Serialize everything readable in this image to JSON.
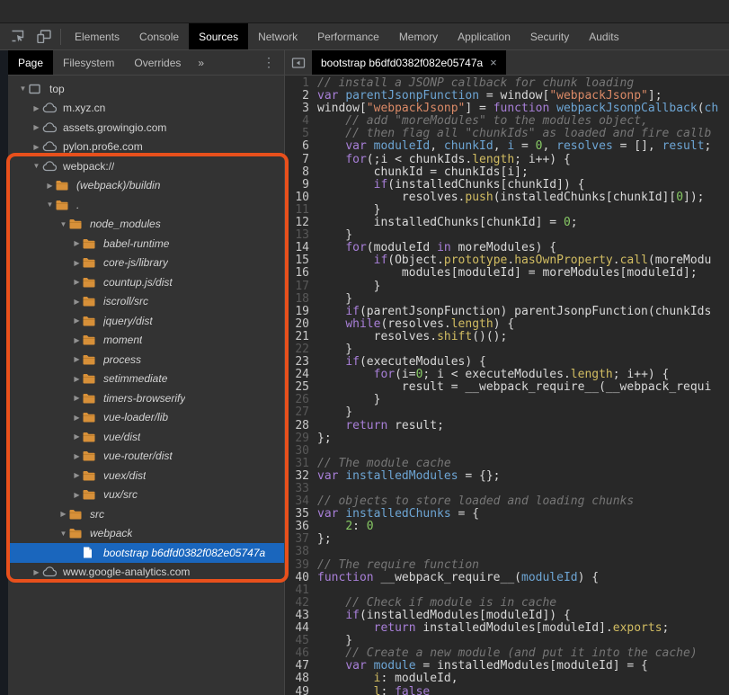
{
  "toolbar": {
    "tabs": [
      "Elements",
      "Console",
      "Sources",
      "Network",
      "Performance",
      "Memory",
      "Application",
      "Security",
      "Audits"
    ],
    "active_tab": "Sources"
  },
  "sidebar": {
    "tabs": [
      "Page",
      "Filesystem",
      "Overrides"
    ],
    "active_tab": "Page",
    "overflow_chevron": "»",
    "more_menu_glyph": "⋮",
    "tree": [
      {
        "label": "top",
        "depth": 0,
        "icon": "frame",
        "expander": "expanded",
        "italic": false,
        "selected": false
      },
      {
        "label": "m.xyz.cn",
        "depth": 1,
        "icon": "cloud",
        "expander": "collapsed",
        "italic": false,
        "selected": false
      },
      {
        "label": "assets.growingio.com",
        "depth": 1,
        "icon": "cloud",
        "expander": "collapsed",
        "italic": false,
        "selected": false
      },
      {
        "label": "pylon.pro6e.com",
        "depth": 1,
        "icon": "cloud",
        "expander": "collapsed",
        "italic": false,
        "selected": false
      },
      {
        "label": "webpack://",
        "depth": 1,
        "icon": "cloud",
        "expander": "expanded",
        "italic": false,
        "selected": false
      },
      {
        "label": "(webpack)/buildin",
        "depth": 2,
        "icon": "folder",
        "expander": "collapsed",
        "italic": true,
        "selected": false
      },
      {
        "label": ".",
        "depth": 2,
        "icon": "folder",
        "expander": "expanded",
        "italic": true,
        "selected": false
      },
      {
        "label": "node_modules",
        "depth": 3,
        "icon": "folder",
        "expander": "expanded",
        "italic": true,
        "selected": false
      },
      {
        "label": "babel-runtime",
        "depth": 4,
        "icon": "folder",
        "expander": "collapsed",
        "italic": true,
        "selected": false
      },
      {
        "label": "core-js/library",
        "depth": 4,
        "icon": "folder",
        "expander": "collapsed",
        "italic": true,
        "selected": false
      },
      {
        "label": "countup.js/dist",
        "depth": 4,
        "icon": "folder",
        "expander": "collapsed",
        "italic": true,
        "selected": false
      },
      {
        "label": "iscroll/src",
        "depth": 4,
        "icon": "folder",
        "expander": "collapsed",
        "italic": true,
        "selected": false
      },
      {
        "label": "jquery/dist",
        "depth": 4,
        "icon": "folder",
        "expander": "collapsed",
        "italic": true,
        "selected": false
      },
      {
        "label": "moment",
        "depth": 4,
        "icon": "folder",
        "expander": "collapsed",
        "italic": true,
        "selected": false
      },
      {
        "label": "process",
        "depth": 4,
        "icon": "folder",
        "expander": "collapsed",
        "italic": true,
        "selected": false
      },
      {
        "label": "setimmediate",
        "depth": 4,
        "icon": "folder",
        "expander": "collapsed",
        "italic": true,
        "selected": false
      },
      {
        "label": "timers-browserify",
        "depth": 4,
        "icon": "folder",
        "expander": "collapsed",
        "italic": true,
        "selected": false
      },
      {
        "label": "vue-loader/lib",
        "depth": 4,
        "icon": "folder",
        "expander": "collapsed",
        "italic": true,
        "selected": false
      },
      {
        "label": "vue/dist",
        "depth": 4,
        "icon": "folder",
        "expander": "collapsed",
        "italic": true,
        "selected": false
      },
      {
        "label": "vue-router/dist",
        "depth": 4,
        "icon": "folder",
        "expander": "collapsed",
        "italic": true,
        "selected": false
      },
      {
        "label": "vuex/dist",
        "depth": 4,
        "icon": "folder",
        "expander": "collapsed",
        "italic": true,
        "selected": false
      },
      {
        "label": "vux/src",
        "depth": 4,
        "icon": "folder",
        "expander": "collapsed",
        "italic": true,
        "selected": false
      },
      {
        "label": "src",
        "depth": 3,
        "icon": "folder",
        "expander": "collapsed",
        "italic": true,
        "selected": false
      },
      {
        "label": "webpack",
        "depth": 3,
        "icon": "folder",
        "expander": "expanded",
        "italic": true,
        "selected": false
      },
      {
        "label": "bootstrap b6dfd0382f082e05747a",
        "depth": 4,
        "icon": "file",
        "expander": "none",
        "italic": true,
        "selected": true
      },
      {
        "label": "www.google-analytics.com",
        "depth": 1,
        "icon": "cloud",
        "expander": "collapsed",
        "italic": false,
        "selected": false
      }
    ]
  },
  "editor": {
    "tab": {
      "label": "bootstrap b6dfd0382f082e05747a",
      "close_glyph": "×"
    },
    "code_lines": [
      {
        "n": 1,
        "x": false,
        "t": [
          [
            "cmt",
            "// install a JSONP callback for chunk loading"
          ]
        ]
      },
      {
        "n": 2,
        "x": true,
        "t": [
          [
            "kw",
            "var"
          ],
          [
            "pln",
            " "
          ],
          [
            "def",
            "parentJsonpFunction"
          ],
          [
            "pln",
            " = window["
          ],
          [
            "str",
            "\"webpackJsonp\""
          ],
          [
            "pln",
            "];"
          ]
        ]
      },
      {
        "n": 3,
        "x": true,
        "t": [
          [
            "pln",
            "window["
          ],
          [
            "str",
            "\"webpackJsonp\""
          ],
          [
            "pln",
            "] = "
          ],
          [
            "kw",
            "function"
          ],
          [
            "pln",
            " "
          ],
          [
            "def",
            "webpackJsonpCallback"
          ],
          [
            "pln",
            "("
          ],
          [
            "def",
            "ch"
          ]
        ]
      },
      {
        "n": 4,
        "x": false,
        "t": [
          [
            "cmt",
            "    // add \"moreModules\" to the modules object,"
          ]
        ]
      },
      {
        "n": 5,
        "x": false,
        "t": [
          [
            "cmt",
            "    // then flag all \"chunkIds\" as loaded and fire callb"
          ]
        ]
      },
      {
        "n": 6,
        "x": true,
        "t": [
          [
            "pln",
            "    "
          ],
          [
            "kw",
            "var"
          ],
          [
            "pln",
            " "
          ],
          [
            "def",
            "moduleId"
          ],
          [
            "pln",
            ", "
          ],
          [
            "def",
            "chunkId"
          ],
          [
            "pln",
            ", "
          ],
          [
            "def",
            "i"
          ],
          [
            "pln",
            " = "
          ],
          [
            "num",
            "0"
          ],
          [
            "pln",
            ", "
          ],
          [
            "def",
            "resolves"
          ],
          [
            "pln",
            " = [], "
          ],
          [
            "def",
            "result"
          ],
          [
            "pln",
            ";"
          ]
        ]
      },
      {
        "n": 7,
        "x": true,
        "t": [
          [
            "pln",
            "    "
          ],
          [
            "kw",
            "for"
          ],
          [
            "pln",
            "(;i < chunkIds."
          ],
          [
            "prop",
            "length"
          ],
          [
            "pln",
            "; i++) {"
          ]
        ]
      },
      {
        "n": 8,
        "x": true,
        "t": [
          [
            "pln",
            "        chunkId = chunkIds[i];"
          ]
        ]
      },
      {
        "n": 9,
        "x": true,
        "t": [
          [
            "pln",
            "        "
          ],
          [
            "kw",
            "if"
          ],
          [
            "pln",
            "(installedChunks[chunkId]) {"
          ]
        ]
      },
      {
        "n": 10,
        "x": true,
        "t": [
          [
            "pln",
            "            resolves."
          ],
          [
            "prop",
            "push"
          ],
          [
            "pln",
            "(installedChunks[chunkId]["
          ],
          [
            "num",
            "0"
          ],
          [
            "pln",
            "]);"
          ]
        ]
      },
      {
        "n": 11,
        "x": false,
        "t": [
          [
            "pln",
            "        }"
          ]
        ]
      },
      {
        "n": 12,
        "x": true,
        "t": [
          [
            "pln",
            "        installedChunks[chunkId] = "
          ],
          [
            "num",
            "0"
          ],
          [
            "pln",
            ";"
          ]
        ]
      },
      {
        "n": 13,
        "x": false,
        "t": [
          [
            "pln",
            "    }"
          ]
        ]
      },
      {
        "n": 14,
        "x": true,
        "t": [
          [
            "pln",
            "    "
          ],
          [
            "kw",
            "for"
          ],
          [
            "pln",
            "(moduleId "
          ],
          [
            "kw",
            "in"
          ],
          [
            "pln",
            " moreModules) {"
          ]
        ]
      },
      {
        "n": 15,
        "x": true,
        "t": [
          [
            "pln",
            "        "
          ],
          [
            "kw",
            "if"
          ],
          [
            "pln",
            "(Object."
          ],
          [
            "prop",
            "prototype"
          ],
          [
            "pln",
            "."
          ],
          [
            "prop",
            "hasOwnProperty"
          ],
          [
            "pln",
            "."
          ],
          [
            "prop",
            "call"
          ],
          [
            "pln",
            "(moreModu"
          ]
        ]
      },
      {
        "n": 16,
        "x": true,
        "t": [
          [
            "pln",
            "            modules[moduleId] = moreModules[moduleId];"
          ]
        ]
      },
      {
        "n": 17,
        "x": false,
        "t": [
          [
            "pln",
            "        }"
          ]
        ]
      },
      {
        "n": 18,
        "x": false,
        "t": [
          [
            "pln",
            "    }"
          ]
        ]
      },
      {
        "n": 19,
        "x": true,
        "t": [
          [
            "pln",
            "    "
          ],
          [
            "kw",
            "if"
          ],
          [
            "pln",
            "(parentJsonpFunction) parentJsonpFunction(chunkIds"
          ]
        ]
      },
      {
        "n": 20,
        "x": true,
        "t": [
          [
            "pln",
            "    "
          ],
          [
            "kw",
            "while"
          ],
          [
            "pln",
            "(resolves."
          ],
          [
            "prop",
            "length"
          ],
          [
            "pln",
            ") {"
          ]
        ]
      },
      {
        "n": 21,
        "x": true,
        "t": [
          [
            "pln",
            "        resolves."
          ],
          [
            "prop",
            "shift"
          ],
          [
            "pln",
            "()();"
          ]
        ]
      },
      {
        "n": 22,
        "x": false,
        "t": [
          [
            "pln",
            "    }"
          ]
        ]
      },
      {
        "n": 23,
        "x": true,
        "t": [
          [
            "pln",
            "    "
          ],
          [
            "kw",
            "if"
          ],
          [
            "pln",
            "(executeModules) {"
          ]
        ]
      },
      {
        "n": 24,
        "x": true,
        "t": [
          [
            "pln",
            "        "
          ],
          [
            "kw",
            "for"
          ],
          [
            "pln",
            "(i="
          ],
          [
            "num",
            "0"
          ],
          [
            "pln",
            "; i < executeModules."
          ],
          [
            "prop",
            "length"
          ],
          [
            "pln",
            "; i++) {"
          ]
        ]
      },
      {
        "n": 25,
        "x": true,
        "t": [
          [
            "pln",
            "            result = __webpack_require__(__webpack_requi"
          ]
        ]
      },
      {
        "n": 26,
        "x": false,
        "t": [
          [
            "pln",
            "        }"
          ]
        ]
      },
      {
        "n": 27,
        "x": false,
        "t": [
          [
            "pln",
            "    }"
          ]
        ]
      },
      {
        "n": 28,
        "x": true,
        "t": [
          [
            "pln",
            "    "
          ],
          [
            "kw",
            "return"
          ],
          [
            "pln",
            " result;"
          ]
        ]
      },
      {
        "n": 29,
        "x": false,
        "t": [
          [
            "pln",
            "};"
          ]
        ]
      },
      {
        "n": 30,
        "x": false,
        "t": []
      },
      {
        "n": 31,
        "x": false,
        "t": [
          [
            "cmt",
            "// The module cache"
          ]
        ]
      },
      {
        "n": 32,
        "x": true,
        "t": [
          [
            "kw",
            "var"
          ],
          [
            "pln",
            " "
          ],
          [
            "def",
            "installedModules"
          ],
          [
            "pln",
            " = {};"
          ]
        ]
      },
      {
        "n": 33,
        "x": false,
        "t": []
      },
      {
        "n": 34,
        "x": false,
        "t": [
          [
            "cmt",
            "// objects to store loaded and loading chunks"
          ]
        ]
      },
      {
        "n": 35,
        "x": true,
        "t": [
          [
            "kw",
            "var"
          ],
          [
            "pln",
            " "
          ],
          [
            "def",
            "installedChunks"
          ],
          [
            "pln",
            " = {"
          ]
        ]
      },
      {
        "n": 36,
        "x": true,
        "t": [
          [
            "pln",
            "    "
          ],
          [
            "num",
            "2"
          ],
          [
            "pln",
            ": "
          ],
          [
            "num",
            "0"
          ]
        ]
      },
      {
        "n": 37,
        "x": false,
        "t": [
          [
            "pln",
            "};"
          ]
        ]
      },
      {
        "n": 38,
        "x": false,
        "t": []
      },
      {
        "n": 39,
        "x": false,
        "t": [
          [
            "cmt",
            "// The require function"
          ]
        ]
      },
      {
        "n": 40,
        "x": true,
        "t": [
          [
            "kw",
            "function"
          ],
          [
            "pln",
            " __webpack_require__("
          ],
          [
            "def",
            "moduleId"
          ],
          [
            "pln",
            ") {"
          ]
        ]
      },
      {
        "n": 41,
        "x": false,
        "t": []
      },
      {
        "n": 42,
        "x": false,
        "t": [
          [
            "cmt",
            "    // Check if module is in cache"
          ]
        ]
      },
      {
        "n": 43,
        "x": true,
        "t": [
          [
            "pln",
            "    "
          ],
          [
            "kw",
            "if"
          ],
          [
            "pln",
            "(installedModules[moduleId]) {"
          ]
        ]
      },
      {
        "n": 44,
        "x": true,
        "t": [
          [
            "pln",
            "        "
          ],
          [
            "kw",
            "return"
          ],
          [
            "pln",
            " installedModules[moduleId]."
          ],
          [
            "prop",
            "exports"
          ],
          [
            "pln",
            ";"
          ]
        ]
      },
      {
        "n": 45,
        "x": false,
        "t": [
          [
            "pln",
            "    }"
          ]
        ]
      },
      {
        "n": 46,
        "x": false,
        "t": [
          [
            "cmt",
            "    // Create a new module (and put it into the cache)"
          ]
        ]
      },
      {
        "n": 47,
        "x": true,
        "t": [
          [
            "pln",
            "    "
          ],
          [
            "kw",
            "var"
          ],
          [
            "pln",
            " "
          ],
          [
            "def",
            "module"
          ],
          [
            "pln",
            " = installedModules[moduleId] = {"
          ]
        ]
      },
      {
        "n": 48,
        "x": true,
        "t": [
          [
            "pln",
            "        "
          ],
          [
            "prop",
            "i"
          ],
          [
            "pln",
            ": moduleId,"
          ]
        ]
      },
      {
        "n": 49,
        "x": true,
        "t": [
          [
            "pln",
            "        "
          ],
          [
            "prop",
            "l"
          ],
          [
            "pln",
            ": "
          ],
          [
            "kw",
            "false"
          ]
        ]
      }
    ]
  },
  "annotation": {
    "type": "highlight-box",
    "color": "#e8501c"
  },
  "colors": {
    "toolbar_bg": "#333333",
    "active_tab_bg": "#000000",
    "editor_bg": "#282828",
    "selection_blue": "#1a66bd",
    "folder_orange": "#d79039",
    "highlight_orange": "#e8501c",
    "syntax_keyword": "#a87fd8",
    "syntax_definition": "#6da5d4",
    "syntax_string": "#db8a67",
    "syntax_number": "#87c964",
    "syntax_property": "#d2bd62",
    "syntax_comment": "#767676"
  }
}
